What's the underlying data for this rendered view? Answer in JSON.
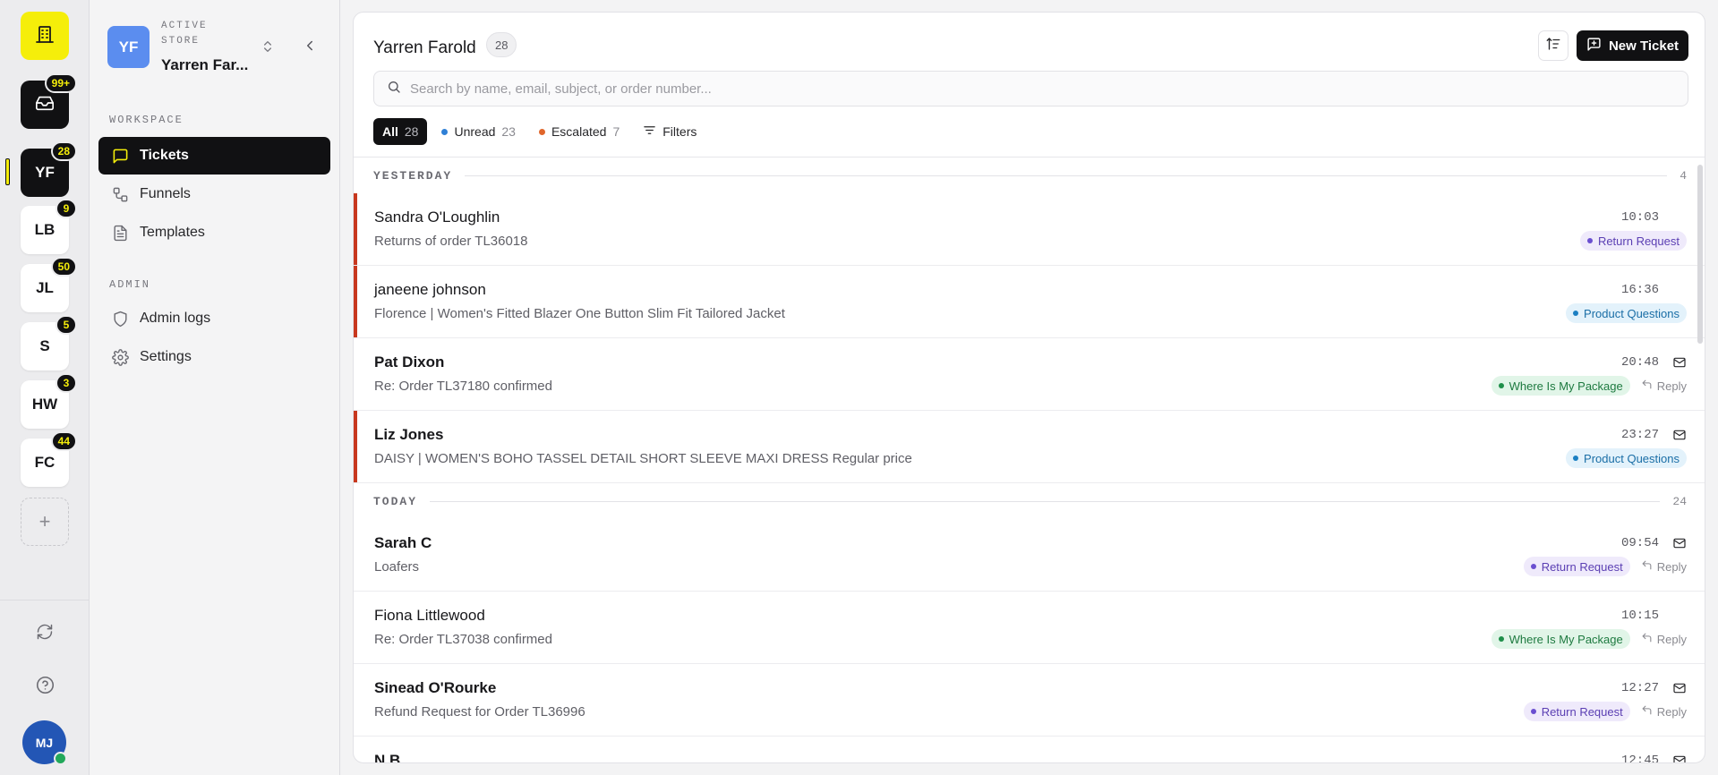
{
  "rail": {
    "inbox_badge": "99+",
    "stores": [
      {
        "initials": "YF",
        "badge": "28",
        "active": true
      },
      {
        "initials": "LB",
        "badge": "9"
      },
      {
        "initials": "JL",
        "badge": "50"
      },
      {
        "initials": "S",
        "badge": "5"
      },
      {
        "initials": "HW",
        "badge": "3"
      },
      {
        "initials": "FC",
        "badge": "44"
      }
    ],
    "add_label": "+",
    "user_initials": "MJ",
    "user_status": "online"
  },
  "sidebar": {
    "store_initials": "YF",
    "store_caption": "ACTIVE STORE",
    "store_name": "Yarren Far...",
    "workspace_label": "WORKSPACE",
    "admin_label": "ADMIN",
    "workspace_items": [
      {
        "label": "Tickets",
        "icon": "message-square-icon",
        "active": true
      },
      {
        "label": "Funnels",
        "icon": "workflow-icon"
      },
      {
        "label": "Templates",
        "icon": "file-text-icon"
      }
    ],
    "admin_items": [
      {
        "label": "Admin logs",
        "icon": "shield-icon"
      },
      {
        "label": "Settings",
        "icon": "gear-icon"
      }
    ]
  },
  "main": {
    "title": "Yarren Farold",
    "count": "28",
    "new_ticket_label": "New Ticket",
    "search_placeholder": "Search by name, email, subject, or order number...",
    "filters": [
      {
        "label": "All",
        "count": "28",
        "active": true
      },
      {
        "label": "Unread",
        "count": "23",
        "dot_color": "#2f80d6"
      },
      {
        "label": "Escalated",
        "count": "7",
        "dot_color": "#e0662b"
      },
      {
        "label": "Filters"
      }
    ]
  },
  "groups": [
    {
      "label": "YESTERDAY",
      "count": "4",
      "tickets": [
        {
          "name": "Sandra O'Loughlin",
          "subject": "Returns of order TL36018",
          "time": "10:03",
          "tag": "Return Request",
          "tag_color": "purple",
          "unread": false,
          "escalated": true,
          "mail": false,
          "reply": ""
        },
        {
          "name": "janeene johnson",
          "subject": "Florence | Women's Fitted Blazer One Button Slim Fit Tailored Jacket",
          "time": "16:36",
          "tag": "Product Questions",
          "tag_color": "blue",
          "unread": false,
          "escalated": true,
          "mail": false,
          "reply": ""
        },
        {
          "name": "Pat Dixon",
          "subject": "Re: Order TL37180 confirmed",
          "time": "20:48",
          "tag": "Where Is My Package",
          "tag_color": "green",
          "unread": true,
          "escalated": false,
          "mail": true,
          "reply": "Reply"
        },
        {
          "name": "Liz Jones",
          "subject": "DAISY | WOMEN'S BOHO TASSEL DETAIL SHORT SLEEVE MAXI DRESS Regular price",
          "time": "23:27",
          "tag": "Product Questions",
          "tag_color": "blue",
          "unread": true,
          "escalated": true,
          "mail": true,
          "reply": ""
        }
      ]
    },
    {
      "label": "TODAY",
      "count": "24",
      "tickets": [
        {
          "name": "Sarah C",
          "subject": "Loafers",
          "time": "09:54",
          "tag": "Return Request",
          "tag_color": "purple",
          "unread": true,
          "escalated": false,
          "mail": true,
          "reply": "Reply"
        },
        {
          "name": "Fiona Littlewood",
          "subject": "Re: Order TL37038 confirmed",
          "time": "10:15",
          "tag": "Where Is My Package",
          "tag_color": "green",
          "unread": false,
          "escalated": false,
          "mail": false,
          "reply": "Reply"
        },
        {
          "name": "Sinead O'Rourke",
          "subject": "Refund Request for Order TL36996",
          "time": "12:27",
          "tag": "Return Request",
          "tag_color": "purple",
          "unread": true,
          "escalated": false,
          "mail": true,
          "reply": "Reply"
        },
        {
          "name": "N B",
          "subject": "",
          "time": "12:45",
          "tag": "",
          "tag_color": "",
          "unread": true,
          "escalated": false,
          "mail": true,
          "reply": ""
        }
      ]
    }
  ]
}
